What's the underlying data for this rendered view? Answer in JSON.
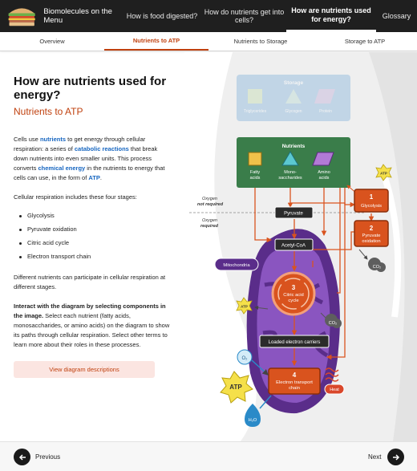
{
  "app": {
    "title": "Biomolecules on the Menu"
  },
  "topnav": [
    {
      "label": "How is food digested?",
      "active": false
    },
    {
      "label": "How do nutrients get into cells?",
      "active": false
    },
    {
      "label": "How are nutrients used for energy?",
      "active": true
    },
    {
      "label": "Glossary",
      "active": false
    }
  ],
  "subtabs": [
    {
      "label": "Overview",
      "active": false
    },
    {
      "label": "Nutrients to ATP",
      "active": true
    },
    {
      "label": "Nutrients to Storage",
      "active": false
    },
    {
      "label": "Storage to ATP",
      "active": false
    }
  ],
  "content": {
    "title": "How are nutrients used for energy?",
    "subtitle": "Nutrients to ATP",
    "intro": {
      "t1": "Cells use ",
      "k1": "nutrients",
      "t2": " to get energy through cellular respiration: a series of ",
      "k2": "catabolic reactions",
      "t3": " that break down nutrients into even smaller units. This process converts ",
      "k3": "chemical energy",
      "t4": " in the nutrients to energy that cells can use, in the form of ",
      "k4": "ATP",
      "t5": "."
    },
    "stages_intro": "Cellular respiration includes these four stages:",
    "stages": [
      "Glycolysis",
      "Pyruvate oxidation",
      "Citric acid cycle",
      "Electron transport chain"
    ],
    "pathways_text": "Different nutrients can participate in cellular respiration at different stages.",
    "interact_bold": "Interact with the diagram by selecting components in the image.",
    "interact_rest": " Select each nutrient (fatty acids, monosaccharides, or amino acids) on the diagram to show its paths through cellular respiration. Select other terms to learn more about their roles in these processes.",
    "desc_button": "View diagram descriptions"
  },
  "diagram": {
    "storage": {
      "title": "Storage",
      "items": [
        "Triglycerides",
        "Glycogen",
        "Protein"
      ]
    },
    "nutrients": {
      "title": "Nutrients",
      "items": [
        "Fatty acids",
        "Mono-saccharides",
        "Amino acids"
      ]
    },
    "oxygen_not_required": {
      "line1": "Oxygen",
      "line2": "not required"
    },
    "oxygen_required": {
      "line1": "Oxygen",
      "line2": "required"
    },
    "pyruvate": "Pyruvate",
    "acetyl": "Acetyl-CoA",
    "mitochondria": "Mitochondria",
    "citric": {
      "num": "3",
      "line1": "Citric acid",
      "line2": "cycle"
    },
    "loaded": "Loaded electron carriers",
    "etc": {
      "num": "4",
      "line1": "Electron transport",
      "line2": "chain"
    },
    "glycolysis": {
      "num": "1",
      "label": "Glycolysis"
    },
    "pyrox": {
      "num": "2",
      "line1": "Pyruvate",
      "line2": "oxidation"
    },
    "atp": "ATP",
    "co2": "CO₂",
    "o2": "O₂",
    "h2o": "H₂O",
    "heat": "Heat",
    "colors": {
      "accent": "#c0410f",
      "green": "#3a7d4a",
      "purple": "#6a3d9a",
      "dark": "#2b2b2b",
      "orange": "#d9531e"
    }
  },
  "footer": {
    "previous": "Previous",
    "next": "Next"
  }
}
